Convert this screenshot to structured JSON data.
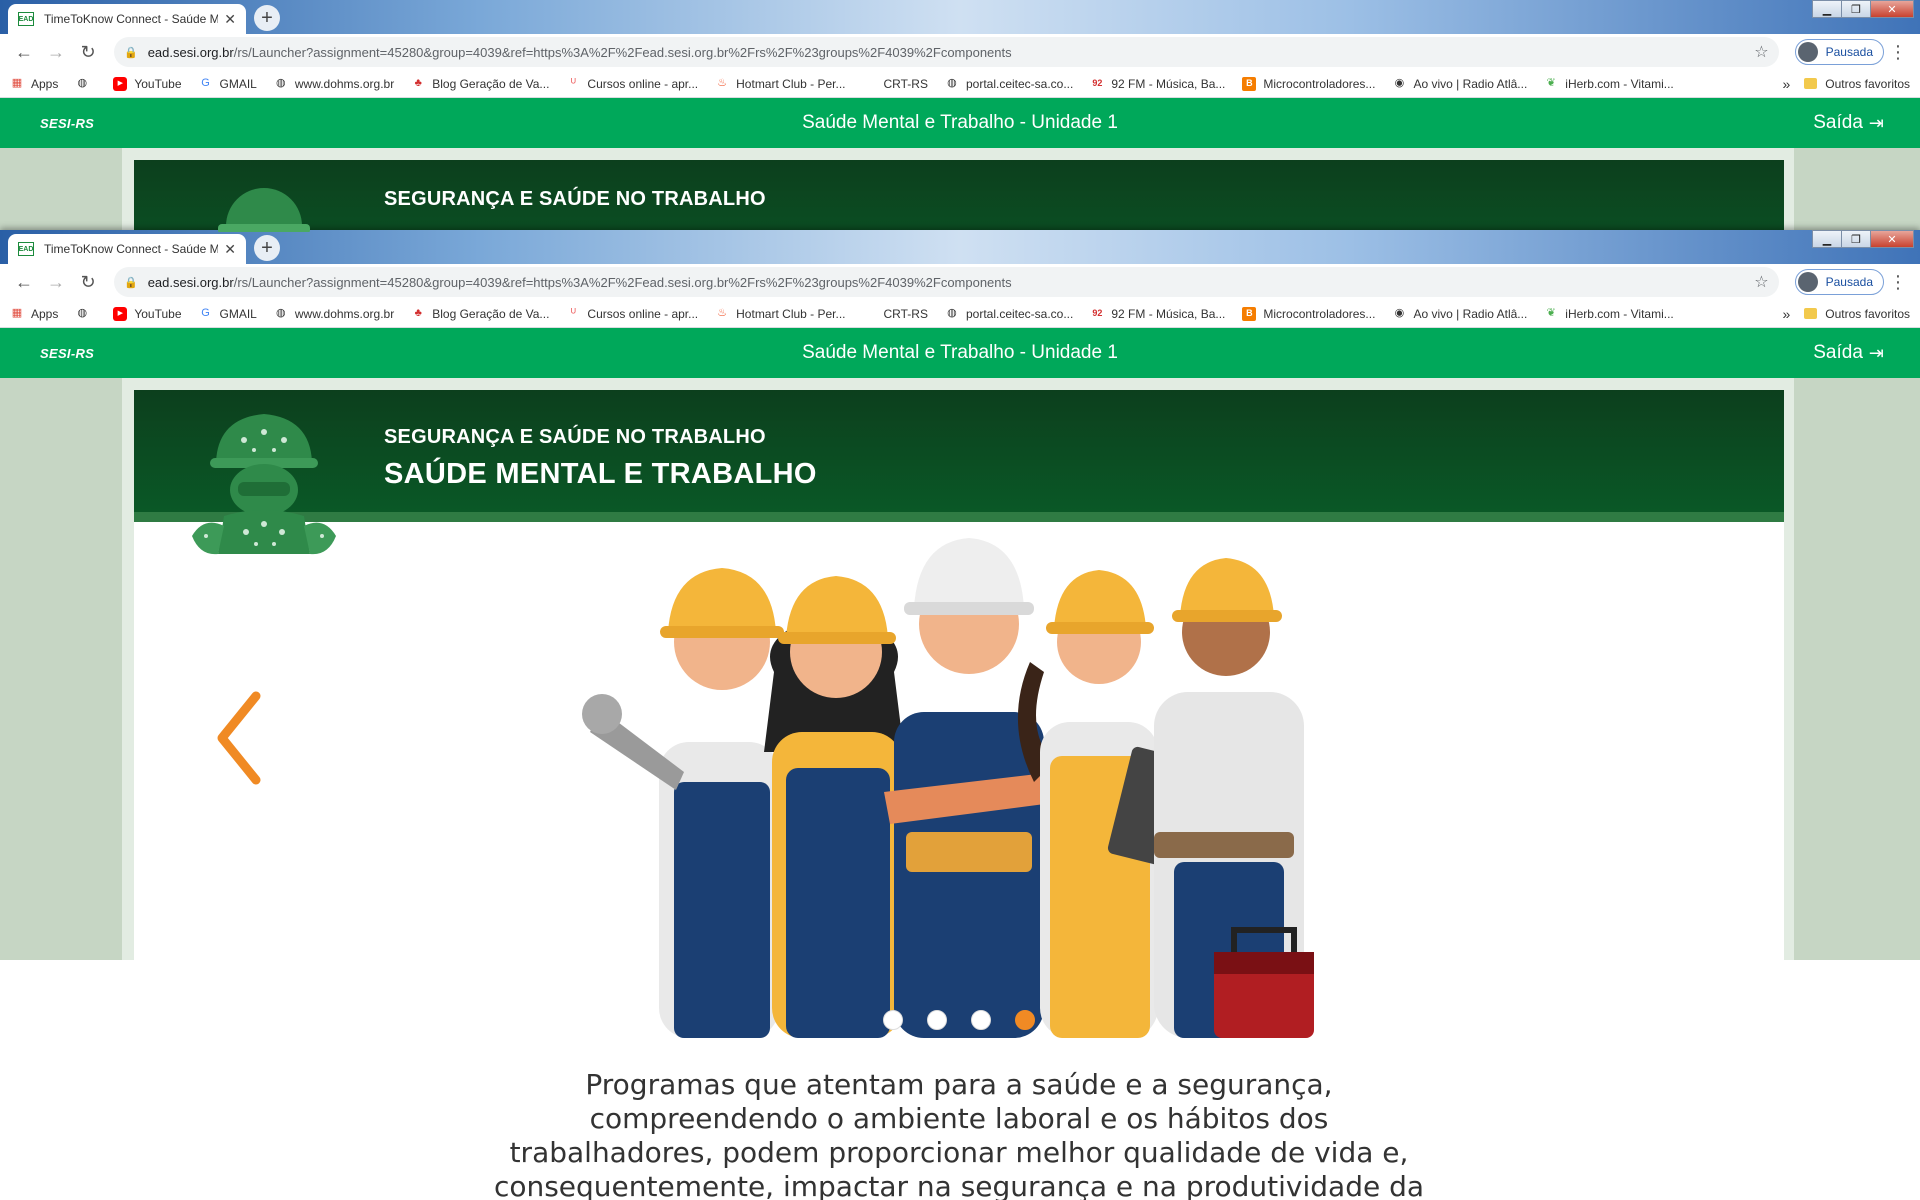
{
  "browser": {
    "tab_title": "TimeToKnow Connect - Saúde M",
    "tab_favicon": "EAD",
    "url_host": "ead.sesi.org.br",
    "url_path": "/rs/Launcher?assignment=45280&group=4039&ref=https%3A%2F%2Fead.sesi.org.br%2Frs%2F%23groups%2F4039%2Fcomponents",
    "profile_label": "Pausada",
    "bookmarks": [
      {
        "label": "Apps",
        "icon": "apps-grid-icon",
        "color": "#e04a3c"
      },
      {
        "label": "",
        "icon": "globe-icon",
        "color": "#333333"
      },
      {
        "label": "YouTube",
        "icon": "youtube-icon",
        "color": "#ff0000"
      },
      {
        "label": "GMAIL",
        "icon": "google-icon",
        "color": "#4285f4"
      },
      {
        "label": "www.dohms.org.br",
        "icon": "globe-icon",
        "color": "#333333"
      },
      {
        "label": "Blog Geração de Va...",
        "icon": "club-icon",
        "color": "#d32f2f"
      },
      {
        "label": "Cursos online - apr...",
        "icon": "udemy-icon",
        "color": "#ec5252"
      },
      {
        "label": "Hotmart Club - Per...",
        "icon": "flame-icon",
        "color": "#f04e23"
      },
      {
        "label": "CRT-RS",
        "icon": "blank-icon",
        "color": "#ffffff"
      },
      {
        "label": "portal.ceitec-sa.co...",
        "icon": "globe-icon",
        "color": "#333333"
      },
      {
        "label": "92 FM - Música, Ba...",
        "icon": "radio-92-icon",
        "color": "#d32f2f"
      },
      {
        "label": "Microcontroladores...",
        "icon": "blogger-icon",
        "color": "#f57d00"
      },
      {
        "label": "Ao vivo | Radio Atlâ...",
        "icon": "radio-icon",
        "color": "#333333"
      },
      {
        "label": "iHerb.com - Vitami...",
        "icon": "leaf-icon",
        "color": "#4caf50"
      }
    ],
    "more_bookmarks": "»",
    "other_favorites": "Outros favoritos"
  },
  "app": {
    "logo": "SESI-RS",
    "title": "Saúde Mental e Trabalho - Unidade 1",
    "exit_label": "Saída",
    "brand_color": "#00a85a"
  },
  "course": {
    "subtitle": "SEGURANÇA E SAÚDE NO TRABALHO",
    "title": "SAÚDE MENTAL E TRABALHO"
  },
  "carousel": {
    "dots_total": 4,
    "active_dot": 4,
    "accent_color": "#f08a24"
  },
  "body_text": "Programas que atentam para a saúde e a segurança, compreendendo o ambiente laboral e os hábitos dos trabalhadores, podem proporcionar melhor qualidade de vida e, consequentemente, impactar na segurança e na produtividade da empresa."
}
